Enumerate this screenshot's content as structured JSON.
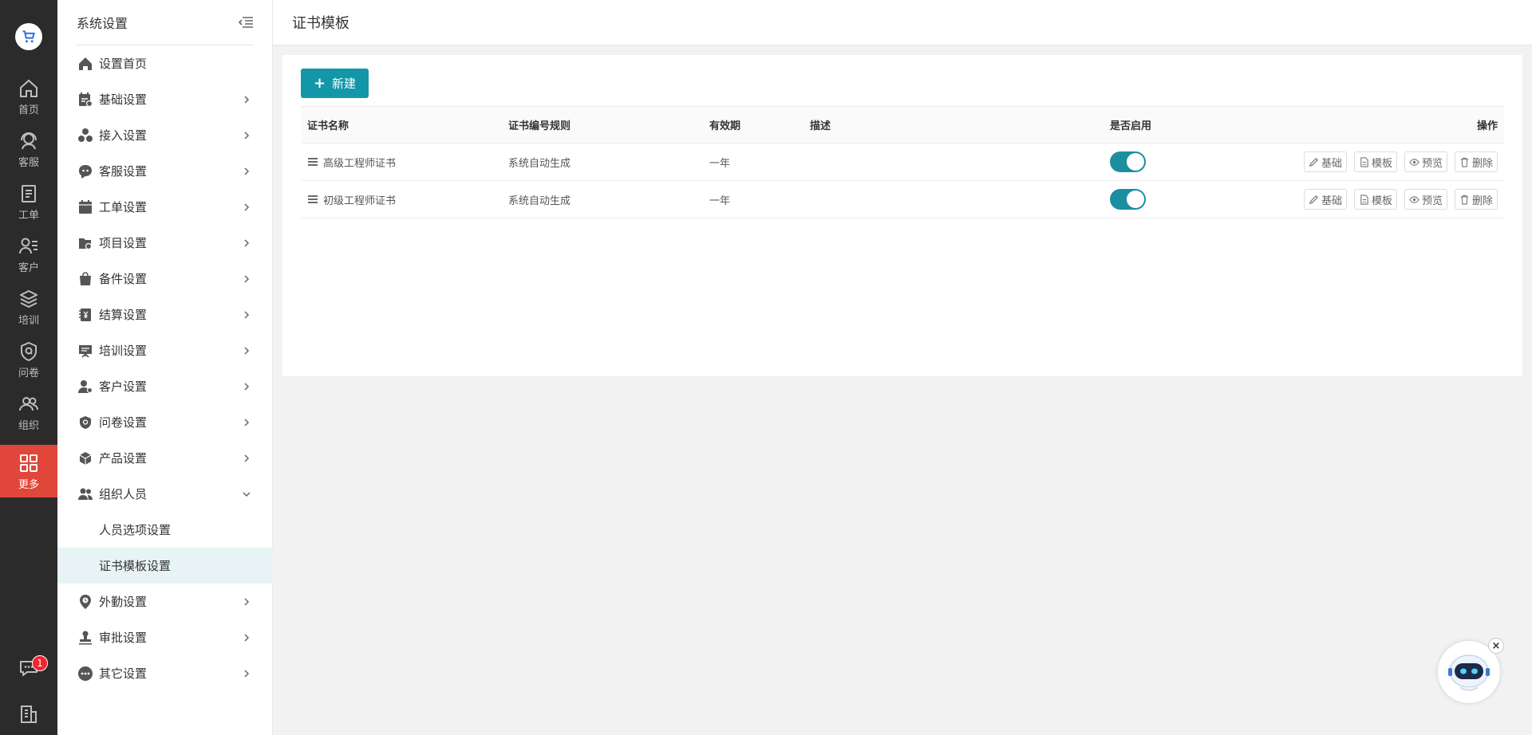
{
  "rail": {
    "items": [
      {
        "label": "首页",
        "icon": "home-icon"
      },
      {
        "label": "客服",
        "icon": "headset-icon"
      },
      {
        "label": "工单",
        "icon": "clipboard-icon"
      },
      {
        "label": "客户",
        "icon": "user-list-icon"
      },
      {
        "label": "培训",
        "icon": "layers-icon"
      },
      {
        "label": "问卷",
        "icon": "shield-q-icon"
      },
      {
        "label": "组织",
        "icon": "group-icon"
      },
      {
        "label": "更多",
        "icon": "grid-icon"
      }
    ],
    "message_badge": "1",
    "active_color": "#e0463a"
  },
  "sidebar": {
    "title": "系统设置",
    "items": [
      {
        "label": "设置首页"
      },
      {
        "label": "基础设置"
      },
      {
        "label": "接入设置"
      },
      {
        "label": "客服设置"
      },
      {
        "label": "工单设置"
      },
      {
        "label": "项目设置"
      },
      {
        "label": "备件设置"
      },
      {
        "label": "结算设置"
      },
      {
        "label": "培训设置"
      },
      {
        "label": "客户设置"
      },
      {
        "label": "问卷设置"
      },
      {
        "label": "产品设置"
      },
      {
        "label": "组织人员"
      },
      {
        "label": "外勤设置"
      },
      {
        "label": "审批设置"
      },
      {
        "label": "其它设置"
      }
    ],
    "sub_items": [
      {
        "label": "人员选项设置"
      },
      {
        "label": "证书模板设置"
      }
    ]
  },
  "main": {
    "title": "证书模板",
    "new_button": "新建",
    "accent": "#1296a8",
    "table": {
      "headers": [
        "证书名称",
        "证书编号规则",
        "有效期",
        "描述",
        "是否启用",
        "操作"
      ],
      "rows": [
        {
          "name": "高级工程师证书",
          "rule": "系统自动生成",
          "validity": "一年",
          "desc": "",
          "enabled": true
        },
        {
          "name": "初级工程师证书",
          "rule": "系统自动生成",
          "validity": "一年",
          "desc": "",
          "enabled": true
        }
      ],
      "actions": [
        "基础",
        "模板",
        "预览",
        "删除"
      ]
    }
  }
}
